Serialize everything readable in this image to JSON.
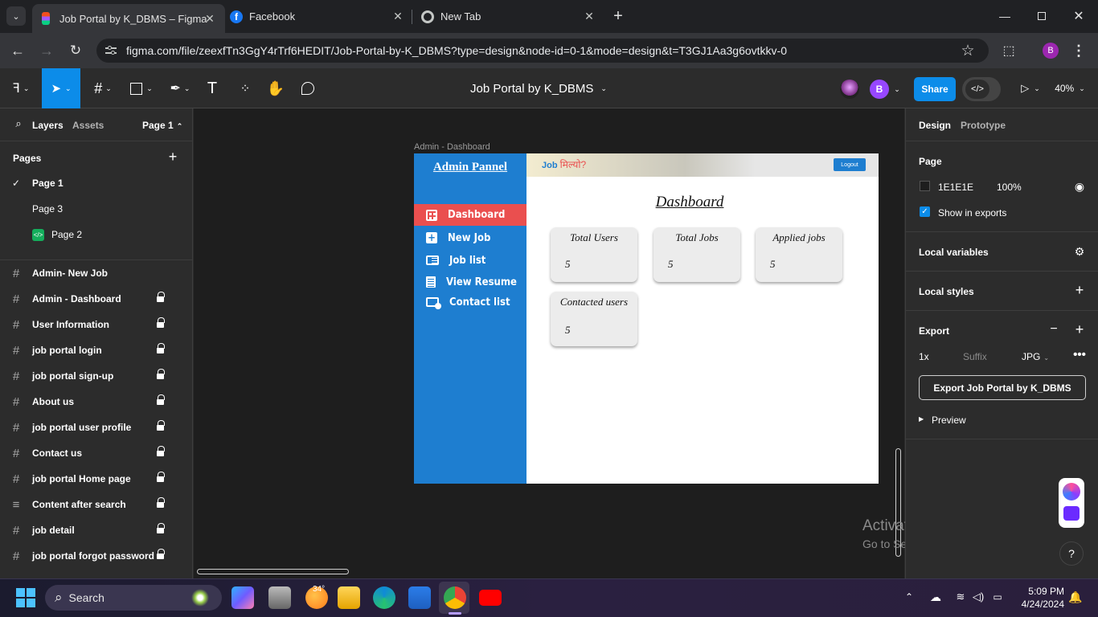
{
  "browser": {
    "tabs": [
      {
        "title": "Job Portal by K_DBMS – Figma",
        "icon": "figma-icon"
      },
      {
        "title": "Facebook",
        "icon": "facebook-icon"
      },
      {
        "title": "New Tab",
        "icon": "chrome-icon"
      }
    ],
    "url": "figma.com/file/zeexfTn3GgY4rTrf6HEDIT/Job-Portal-by-K_DBMS?type=design&node-id=0-1&mode=design&t=T3GJ1Aa3g6ovtkkv-0",
    "profile_initial": "B"
  },
  "figma": {
    "file_title": "Job Portal by K_DBMS",
    "avatar_initial": "B",
    "share_label": "Share",
    "zoom": "40%",
    "left_tabs": {
      "layers": "Layers",
      "assets": "Assets",
      "page_selector": "Page 1"
    },
    "pages_header": "Pages",
    "pages": [
      {
        "name": "Page 1",
        "selected": true
      },
      {
        "name": "Page 3",
        "selected": false
      },
      {
        "name": "Page 2",
        "selected": false
      }
    ],
    "layers": [
      {
        "name": "Admin- New Job",
        "icon": "hash",
        "locked": false
      },
      {
        "name": "Admin - Dashboard",
        "icon": "hash",
        "locked": true
      },
      {
        "name": "User Information",
        "icon": "hash",
        "locked": true
      },
      {
        "name": "job portal login",
        "icon": "hash",
        "locked": true
      },
      {
        "name": "job portal sign-up",
        "icon": "hash",
        "locked": true
      },
      {
        "name": "About us",
        "icon": "hash",
        "locked": true
      },
      {
        "name": "job portal user profile",
        "icon": "hash",
        "locked": true
      },
      {
        "name": "Contact us",
        "icon": "hash",
        "locked": true
      },
      {
        "name": "job portal Home page",
        "icon": "hash",
        "locked": true
      },
      {
        "name": "Content after search",
        "icon": "lines",
        "locked": true
      },
      {
        "name": "job detail",
        "icon": "hash",
        "locked": true
      },
      {
        "name": "job portal forgot password",
        "icon": "hash",
        "locked": true
      }
    ],
    "right": {
      "tabs": {
        "design": "Design",
        "prototype": "Prototype"
      },
      "page_label": "Page",
      "page_color": "1E1E1E",
      "page_opacity": "100%",
      "show_in_exports": "Show in exports",
      "local_variables": "Local variables",
      "local_styles": "Local styles",
      "export_label": "Export",
      "export_scale": "1x",
      "export_suffix_placeholder": "Suffix",
      "export_format": "JPG",
      "export_button": "Export Job Portal by K_DBMS",
      "preview": "Preview"
    },
    "frame": {
      "label": "Admin - Dashboard",
      "sidebar_title": "Admin Pannel",
      "logo_en": "Job",
      "logo_hi": "मिल्यो?",
      "logout": "Logout",
      "heading": "Dashboard",
      "nav": [
        {
          "label": "Dashboard",
          "icon": "dashboard-grid-icon",
          "active": true
        },
        {
          "label": "New Job",
          "icon": "plus-square-icon",
          "active": false
        },
        {
          "label": "Job list",
          "icon": "list-card-icon",
          "active": false
        },
        {
          "label": "View Resume",
          "icon": "document-icon",
          "active": false
        },
        {
          "label": "Contact list",
          "icon": "contact-card-icon",
          "active": false
        }
      ],
      "cards": [
        {
          "title": "Total Users",
          "value": "5"
        },
        {
          "title": "Total Jobs",
          "value": "5"
        },
        {
          "title": "Applied jobs",
          "value": "5"
        },
        {
          "title": "Contacted users",
          "value": "5"
        }
      ]
    },
    "watermark": {
      "title": "Activate Windows",
      "subtitle": "Go to Settings to activate Windows."
    },
    "help": "?"
  },
  "taskbar": {
    "search_placeholder": "Search",
    "weather": "34°",
    "time": "5:09 PM",
    "date": "4/24/2024"
  },
  "colors": {
    "figma_blue": "#0c8ce9",
    "frame_sidebar": "#1e7ed0",
    "active_nav": "#ea4f4f",
    "avatar_purple": "#9747ff"
  }
}
